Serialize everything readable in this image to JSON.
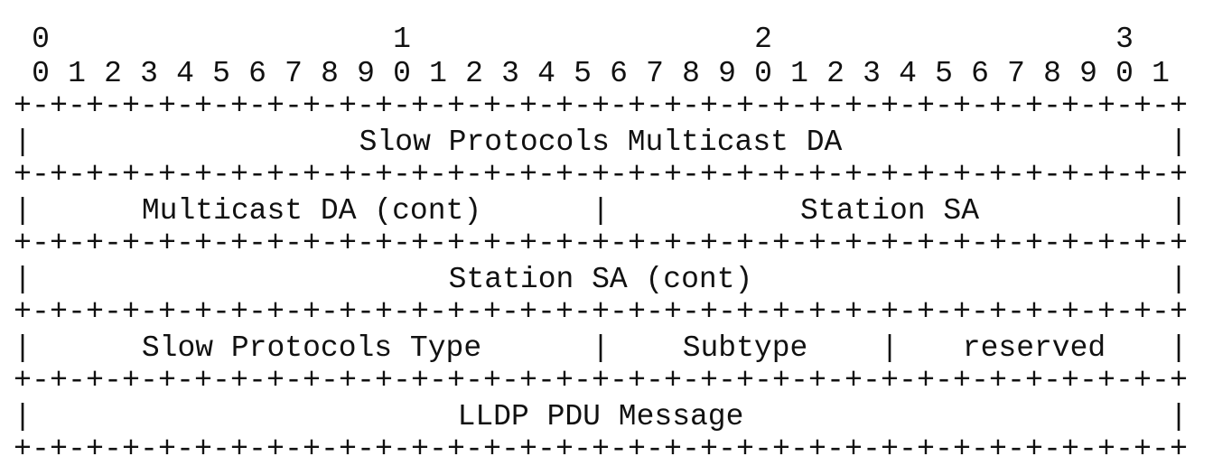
{
  "diagram": {
    "header_tens": [
      "0",
      "1",
      "2",
      "3"
    ],
    "header_units": [
      "0",
      "1",
      "2",
      "3",
      "4",
      "5",
      "6",
      "7",
      "8",
      "9",
      "0",
      "1",
      "2",
      "3",
      "4",
      "5",
      "6",
      "7",
      "8",
      "9",
      "0",
      "1",
      "2",
      "3",
      "4",
      "5",
      "6",
      "7",
      "8",
      "9",
      "0",
      "1"
    ],
    "separator": "+-+-+-+-+-+-+-+-+-+-+-+-+-+-+-+-+-+-+-+-+-+-+-+-+-+-+-+-+-+-+-+-+",
    "edge": "|",
    "rows": [
      {
        "fields": [
          {
            "label": "Slow Protocols Multicast DA",
            "bits": 32
          }
        ]
      },
      {
        "fields": [
          {
            "label": "Multicast DA (cont)",
            "bits": 16
          },
          {
            "label": "Station SA",
            "bits": 16
          }
        ]
      },
      {
        "fields": [
          {
            "label": "Station SA (cont)",
            "bits": 32
          }
        ]
      },
      {
        "fields": [
          {
            "label": "Slow Protocols Type",
            "bits": 16
          },
          {
            "label": "Subtype",
            "bits": 8
          },
          {
            "label": "reserved",
            "bits": 8
          }
        ]
      },
      {
        "fields": [
          {
            "label": "LLDP PDU Message",
            "bits": 32
          }
        ]
      }
    ]
  }
}
